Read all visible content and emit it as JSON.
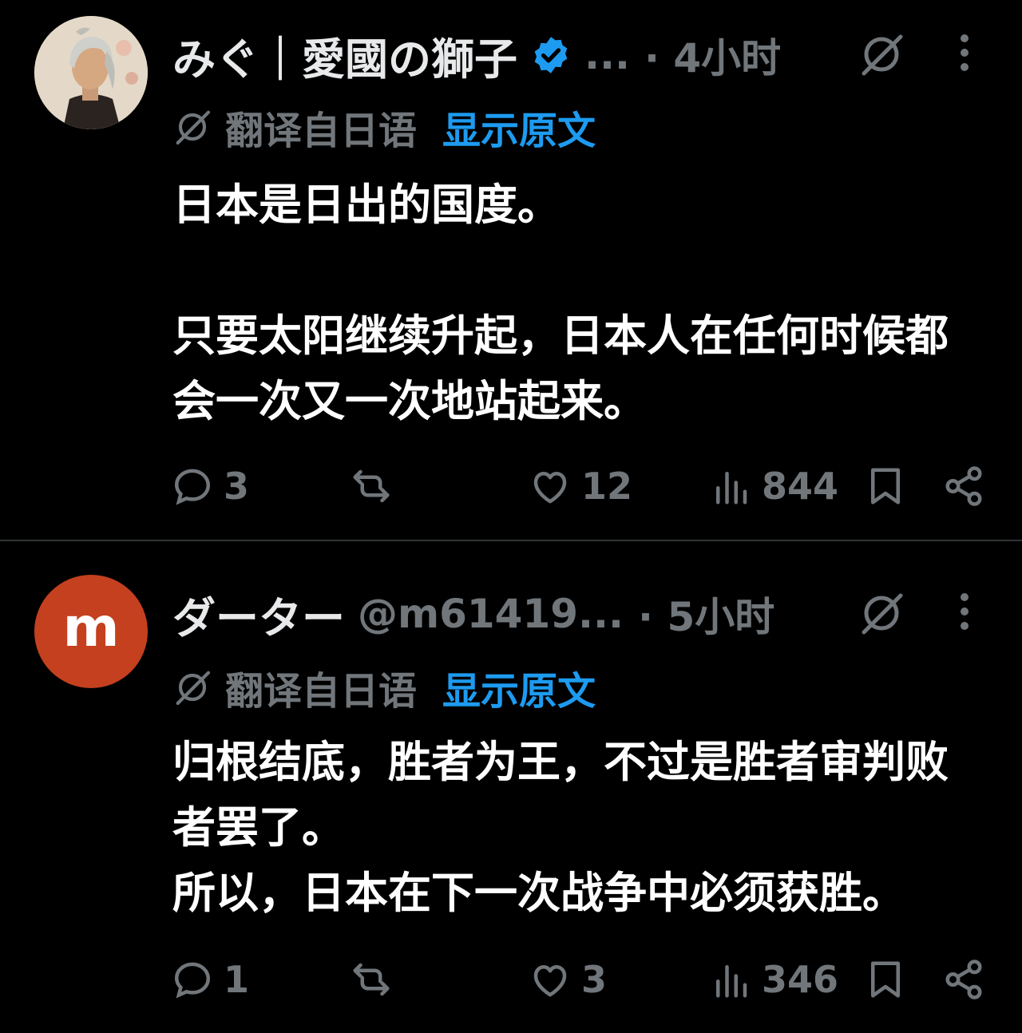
{
  "posts": [
    {
      "name": "みぐ｜愛國の獅子",
      "handle": "...",
      "time": "· 4小时",
      "translation_label": "翻译自日语",
      "show_original": "显示原文",
      "body_lines": [
        "日本是日出的国度。",
        "",
        "只要太阳继续升起，日本人在任何时候都",
        "会一次又一次地站起来。"
      ],
      "stats": {
        "replies": "3",
        "reposts": "",
        "likes": "12",
        "views": "844"
      }
    },
    {
      "name": "ダーター",
      "handle": "@m61419...",
      "avatar_letter": "m",
      "time": "· 5小时",
      "translation_label": "翻译自日语",
      "show_original": "显示原文",
      "body_lines": [
        "归根结底，胜者为王，不过是胜者审判败",
        "者罢了。",
        "所以，日本在下一次战争中必须获胜。"
      ],
      "stats": {
        "replies": "1",
        "reposts": "",
        "likes": "3",
        "views": "346"
      }
    }
  ],
  "colors": {
    "background": "#000000",
    "text": "#e7e9ea",
    "muted": "#71767b",
    "link": "#1d9bf0",
    "verified": "#1d9bf0",
    "avatar_m": "#c4401f"
  },
  "icons": [
    "reply-icon",
    "repost-icon",
    "like-icon",
    "views-icon",
    "bookmark-icon",
    "share-icon",
    "grok-icon",
    "more-icon",
    "verified-badge-icon"
  ]
}
